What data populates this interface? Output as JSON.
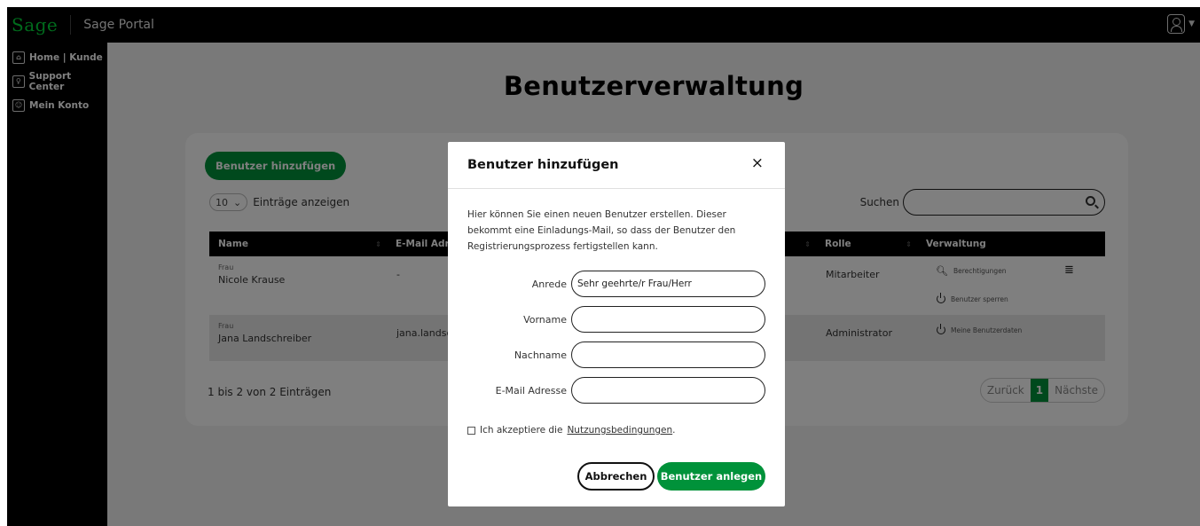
{
  "header": {
    "logo": "Sage",
    "portal_title": "Sage Portal"
  },
  "sidebar": {
    "items": [
      {
        "label": "Home | Kunde",
        "icon": "home-icon"
      },
      {
        "label": "Support Center",
        "icon": "lightbulb-icon"
      },
      {
        "label": "Mein Konto",
        "icon": "user-icon"
      }
    ]
  },
  "main": {
    "title": "Benutzerverwaltung",
    "add_button": "Benutzer hinzufügen",
    "entries_value": "10",
    "entries_label": "Einträge anzeigen",
    "search_label": "Suchen",
    "columns": [
      "Name",
      "E-Mail Adresse",
      "Rolle",
      "Verwaltung"
    ],
    "rows": [
      {
        "salutation": "Frau",
        "name": "Nicole Krause",
        "email": "-",
        "role": "Mitarbeiter",
        "actions": [
          "Berechtigungen",
          "Benutzer sperren"
        ]
      },
      {
        "salutation": "Frau",
        "name": "Jana Landschreiber",
        "email": "jana.landsch",
        "role": "Administrator",
        "actions": [
          "Meine Benutzerdaten"
        ]
      }
    ],
    "info": "1 bis 2 von 2 Einträgen",
    "pager": {
      "prev": "Zurück",
      "current": "1",
      "next": "Nächste"
    }
  },
  "modal": {
    "title": "Benutzer hinzufügen",
    "close": "×",
    "description": "Hier können Sie einen neuen Benutzer erstellen. Dieser bekommt eine Einladungs-Mail, so dass der Benutzer den Registrierungsprozess fertigstellen kann.",
    "fields": [
      {
        "label": "Anrede",
        "value": "Sehr geehrte/r Frau/Herr"
      },
      {
        "label": "Vorname",
        "value": ""
      },
      {
        "label": "Nachname",
        "value": ""
      },
      {
        "label": "E-Mail Adresse",
        "value": ""
      }
    ],
    "terms_prefix": "Ich akzeptiere die",
    "terms_link": "Nutzungsbedingungen",
    "terms_suffix": ".",
    "cancel": "Abbrechen",
    "submit": "Benutzer anlegen"
  },
  "colors": {
    "accent": "#00923a",
    "logo": "#00d639",
    "topbar": "#000000"
  }
}
